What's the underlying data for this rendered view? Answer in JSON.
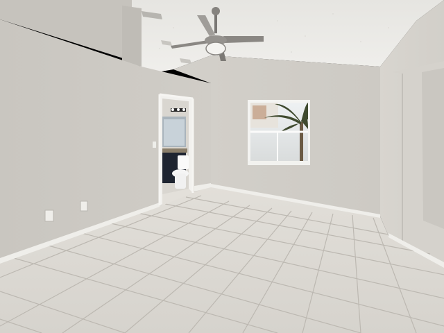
{
  "image": {
    "subject": "empty-room-interior",
    "colors": {
      "wall": "#cfccc6",
      "wall_shadow": "#c4c1bb",
      "ceiling": "#e9e8e4",
      "floor_tile": "#dedad3",
      "grout": "#b9b5ae",
      "baseboard": "#efeeea",
      "bathroom_vanity": "#1e2430",
      "palm_green": "#3f4a2f"
    },
    "icons": [
      "ceiling-fan-icon",
      "window-icon",
      "doorway-icon",
      "toilet-icon",
      "outlet-icon"
    ]
  }
}
